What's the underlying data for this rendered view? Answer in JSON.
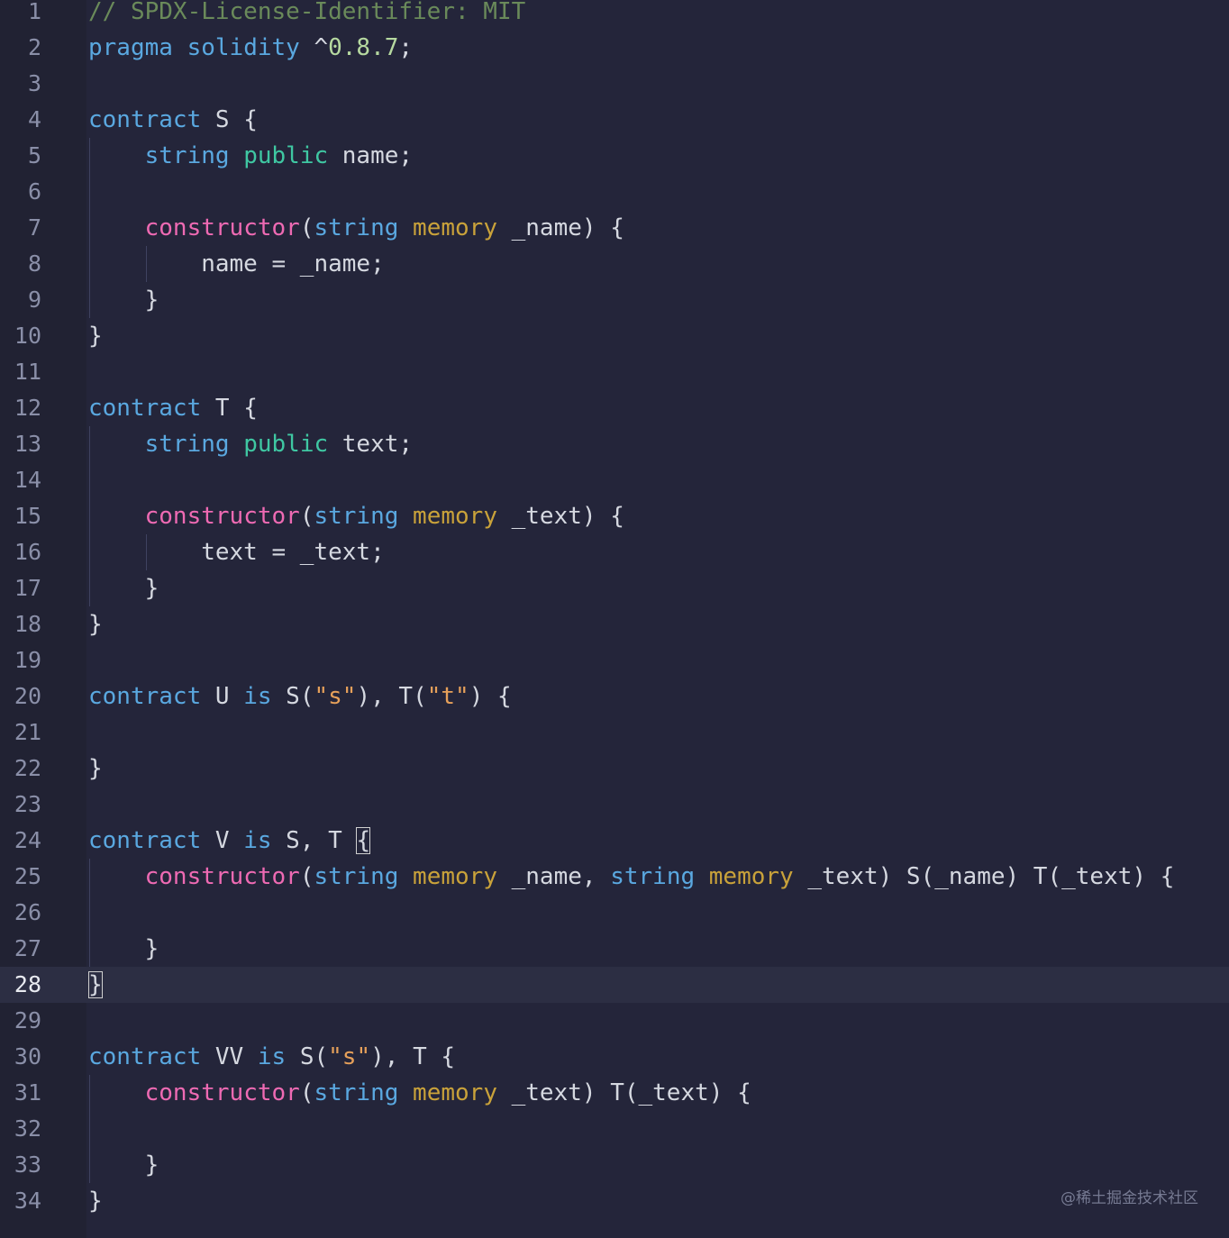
{
  "editor": {
    "current_line": 28,
    "lines": [
      {
        "n": "1",
        "tokens": [
          {
            "c": "comment",
            "t": "// SPDX-License-Identifier: MIT"
          }
        ]
      },
      {
        "n": "2",
        "tokens": [
          {
            "c": "kw",
            "t": "pragma"
          },
          {
            "c": "id",
            "t": " "
          },
          {
            "c": "kw",
            "t": "solidity"
          },
          {
            "c": "id",
            "t": " ^"
          },
          {
            "c": "num",
            "t": "0.8.7"
          },
          {
            "c": "id",
            "t": ";"
          }
        ]
      },
      {
        "n": "3",
        "tokens": []
      },
      {
        "n": "4",
        "tokens": [
          {
            "c": "kw",
            "t": "contract"
          },
          {
            "c": "id",
            "t": " S {"
          }
        ]
      },
      {
        "n": "5",
        "tokens": [
          {
            "c": "id",
            "t": "    "
          },
          {
            "c": "kw",
            "t": "string"
          },
          {
            "c": "id",
            "t": " "
          },
          {
            "c": "mod",
            "t": "public"
          },
          {
            "c": "id",
            "t": " name;"
          }
        ]
      },
      {
        "n": "6",
        "tokens": []
      },
      {
        "n": "7",
        "tokens": [
          {
            "c": "id",
            "t": "    "
          },
          {
            "c": "fn",
            "t": "constructor"
          },
          {
            "c": "id",
            "t": "("
          },
          {
            "c": "kw",
            "t": "string"
          },
          {
            "c": "id",
            "t": " "
          },
          {
            "c": "mem",
            "t": "memory"
          },
          {
            "c": "id",
            "t": " _name) {"
          }
        ]
      },
      {
        "n": "8",
        "tokens": [
          {
            "c": "id",
            "t": "        name = _name;"
          }
        ]
      },
      {
        "n": "9",
        "tokens": [
          {
            "c": "id",
            "t": "    }"
          }
        ]
      },
      {
        "n": "10",
        "tokens": [
          {
            "c": "id",
            "t": "}"
          }
        ]
      },
      {
        "n": "11",
        "tokens": []
      },
      {
        "n": "12",
        "tokens": [
          {
            "c": "kw",
            "t": "contract"
          },
          {
            "c": "id",
            "t": " T {"
          }
        ]
      },
      {
        "n": "13",
        "tokens": [
          {
            "c": "id",
            "t": "    "
          },
          {
            "c": "kw",
            "t": "string"
          },
          {
            "c": "id",
            "t": " "
          },
          {
            "c": "mod",
            "t": "public"
          },
          {
            "c": "id",
            "t": " text;"
          }
        ]
      },
      {
        "n": "14",
        "tokens": []
      },
      {
        "n": "15",
        "tokens": [
          {
            "c": "id",
            "t": "    "
          },
          {
            "c": "fn",
            "t": "constructor"
          },
          {
            "c": "id",
            "t": "("
          },
          {
            "c": "kw",
            "t": "string"
          },
          {
            "c": "id",
            "t": " "
          },
          {
            "c": "mem",
            "t": "memory"
          },
          {
            "c": "id",
            "t": " _text) {"
          }
        ]
      },
      {
        "n": "16",
        "tokens": [
          {
            "c": "id",
            "t": "        text = _text;"
          }
        ]
      },
      {
        "n": "17",
        "tokens": [
          {
            "c": "id",
            "t": "    }"
          }
        ]
      },
      {
        "n": "18",
        "tokens": [
          {
            "c": "id",
            "t": "}"
          }
        ]
      },
      {
        "n": "19",
        "tokens": []
      },
      {
        "n": "20",
        "tokens": [
          {
            "c": "kw",
            "t": "contract"
          },
          {
            "c": "id",
            "t": " U "
          },
          {
            "c": "kw",
            "t": "is"
          },
          {
            "c": "id",
            "t": " S("
          },
          {
            "c": "str",
            "t": "\"s\""
          },
          {
            "c": "id",
            "t": "), T("
          },
          {
            "c": "str",
            "t": "\"t\""
          },
          {
            "c": "id",
            "t": ") {"
          }
        ]
      },
      {
        "n": "21",
        "tokens": []
      },
      {
        "n": "22",
        "tokens": [
          {
            "c": "id",
            "t": "}"
          }
        ]
      },
      {
        "n": "23",
        "tokens": []
      },
      {
        "n": "24",
        "tokens": [
          {
            "c": "kw",
            "t": "contract"
          },
          {
            "c": "id",
            "t": " V "
          },
          {
            "c": "kw",
            "t": "is"
          },
          {
            "c": "id",
            "t": " S, T "
          },
          {
            "c": "bracket",
            "t": "{"
          }
        ]
      },
      {
        "n": "25",
        "tokens": [
          {
            "c": "id",
            "t": "    "
          },
          {
            "c": "fn",
            "t": "constructor"
          },
          {
            "c": "id",
            "t": "("
          },
          {
            "c": "kw",
            "t": "string"
          },
          {
            "c": "id",
            "t": " "
          },
          {
            "c": "mem",
            "t": "memory"
          },
          {
            "c": "id",
            "t": " _name, "
          },
          {
            "c": "kw",
            "t": "string"
          },
          {
            "c": "id",
            "t": " "
          },
          {
            "c": "mem",
            "t": "memory"
          },
          {
            "c": "id",
            "t": " _text) S(_name) T(_text) {"
          }
        ]
      },
      {
        "n": "26",
        "tokens": []
      },
      {
        "n": "27",
        "tokens": [
          {
            "c": "id",
            "t": "    }"
          }
        ]
      },
      {
        "n": "28",
        "tokens": [
          {
            "c": "bracket",
            "t": "}"
          }
        ]
      },
      {
        "n": "29",
        "tokens": []
      },
      {
        "n": "30",
        "tokens": [
          {
            "c": "kw",
            "t": "contract"
          },
          {
            "c": "id",
            "t": " VV "
          },
          {
            "c": "kw",
            "t": "is"
          },
          {
            "c": "id",
            "t": " S("
          },
          {
            "c": "str",
            "t": "\"s\""
          },
          {
            "c": "id",
            "t": "), T {"
          }
        ]
      },
      {
        "n": "31",
        "tokens": [
          {
            "c": "id",
            "t": "    "
          },
          {
            "c": "fn",
            "t": "constructor"
          },
          {
            "c": "id",
            "t": "("
          },
          {
            "c": "kw",
            "t": "string"
          },
          {
            "c": "id",
            "t": " "
          },
          {
            "c": "mem",
            "t": "memory"
          },
          {
            "c": "id",
            "t": " _text) T(_text) {"
          }
        ]
      },
      {
        "n": "32",
        "tokens": []
      },
      {
        "n": "33",
        "tokens": [
          {
            "c": "id",
            "t": "    }"
          }
        ]
      },
      {
        "n": "34",
        "tokens": [
          {
            "c": "id",
            "t": "}"
          }
        ]
      }
    ]
  },
  "watermark": "@稀土掘金技术社区",
  "colors": {
    "background": "#24253a",
    "gutter": "#212233",
    "keyword": "#5aa8e0",
    "modifier": "#3fc7a2",
    "function": "#ee6ab3",
    "memory": "#c9a23a",
    "string": "#e6a05a",
    "comment": "#6a8a5a"
  }
}
